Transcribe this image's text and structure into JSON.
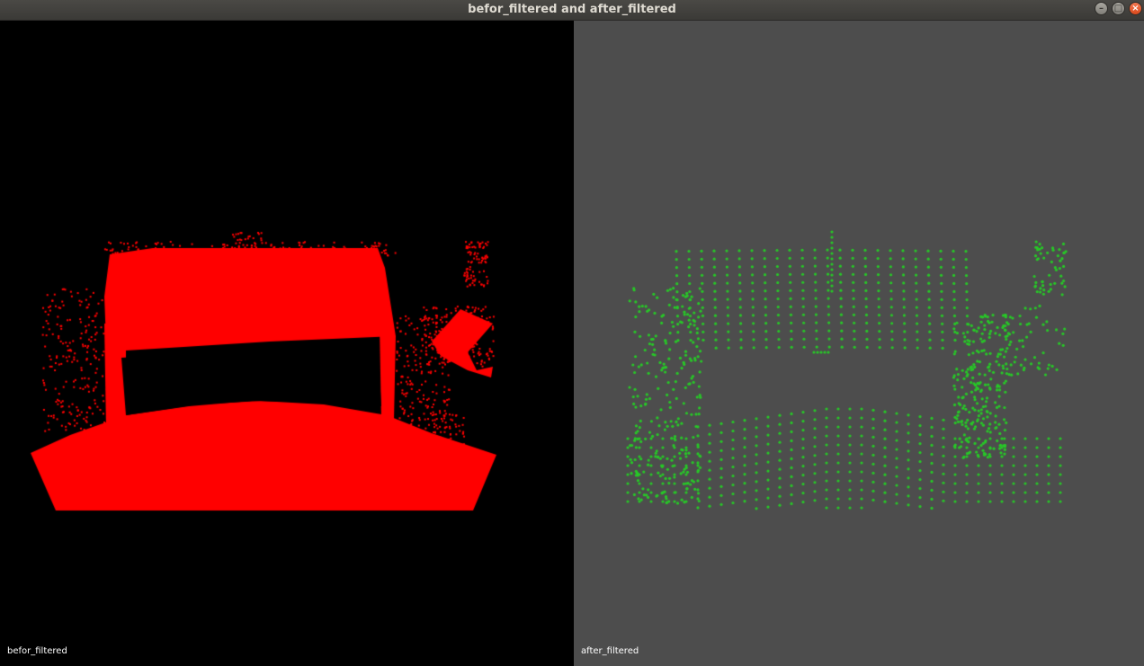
{
  "window": {
    "title": "befor_filtered and after_filtered",
    "controls": {
      "minimize_icon": "minimize-icon",
      "maximize_icon": "maximize-icon",
      "close_icon": "close-icon"
    }
  },
  "viewports": [
    {
      "label": "befor_filtered",
      "background": "#000000",
      "point_color": "#ff0000"
    },
    {
      "label": "after_filtered",
      "background": "#4d4d4d",
      "point_color": "#27c927"
    }
  ]
}
